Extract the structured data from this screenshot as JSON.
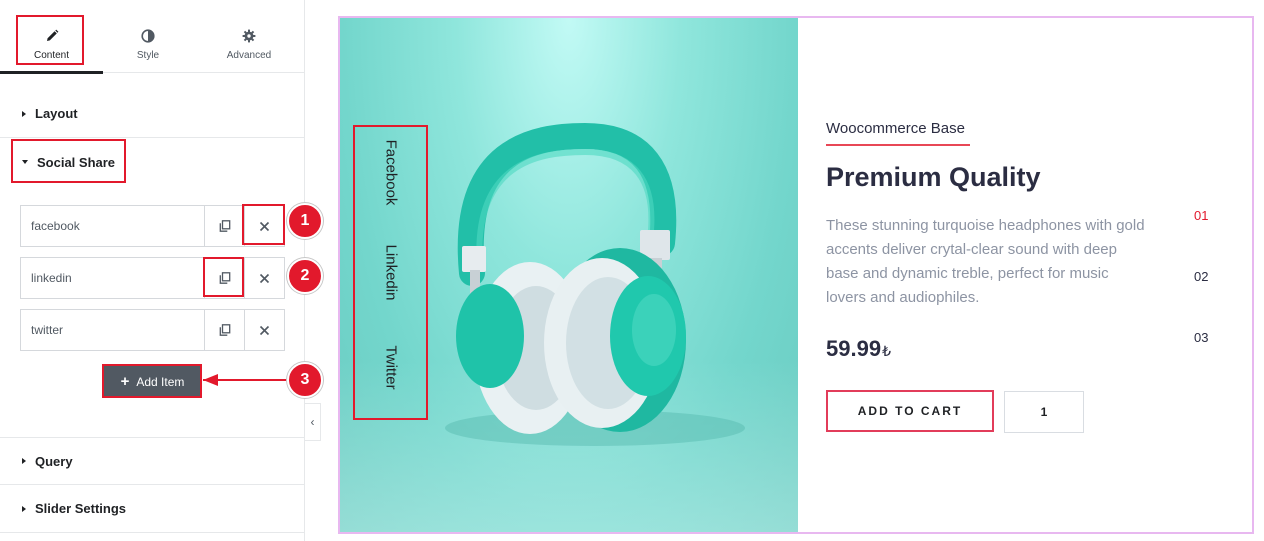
{
  "tabs": [
    {
      "label": "Content",
      "icon": "pencil-icon"
    },
    {
      "label": "Style",
      "icon": "half-circle-icon"
    },
    {
      "label": "Advanced",
      "icon": "gear-icon"
    }
  ],
  "sections": {
    "layout": "Layout",
    "social_share": "Social Share",
    "query": "Query",
    "slider_settings": "Slider Settings"
  },
  "social_items": [
    {
      "label": "facebook"
    },
    {
      "label": "linkedin"
    },
    {
      "label": "twitter"
    }
  ],
  "add_item_label": "Add Item",
  "annotations": [
    "1",
    "2",
    "3"
  ],
  "collapse_glyph": "‹",
  "preview": {
    "social_links": [
      "Facebook",
      "Linkedin",
      "Twitter"
    ],
    "subtitle": "Woocommerce Base",
    "title": "Premium Quality",
    "description": "These stunning turquoise headphones with gold accents deliver crytal-clear sound with deep base and dynamic treble, perfect for music lovers and audiophiles.",
    "price": "59.99",
    "currency": "₺",
    "add_to_cart": "ADD TO CART",
    "quantity": "1",
    "pagination": [
      "01",
      "02",
      "03"
    ]
  },
  "colors": {
    "accent": "#e2192c",
    "panel_text": "#1f2124",
    "muted": "#515962",
    "hero_bg": "#73d6cc",
    "preview_border": "#e8b8f0"
  }
}
